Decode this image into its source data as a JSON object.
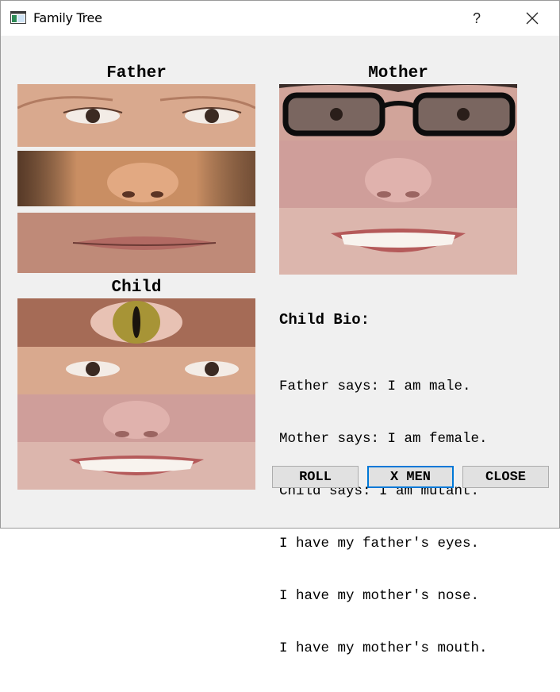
{
  "window": {
    "title": "Family Tree",
    "help_label": "?"
  },
  "sections": {
    "father": "Father",
    "mother": "Mother",
    "child": "Child"
  },
  "bio": {
    "title": "Child Bio:",
    "lines": [
      "Father says: I am male.",
      "Mother says: I am female.",
      "Child says: I am mutant.",
      "I have my father's eyes.",
      "I have my mother's nose.",
      "I have my mother's mouth."
    ]
  },
  "buttons": {
    "roll": "ROLL",
    "xmen": "X MEN",
    "close": "CLOSE"
  },
  "icons": {
    "app": "app-window-icon",
    "close": "close-icon"
  },
  "colors": {
    "accent": "#0078d7",
    "button_bg": "#e1e1e1",
    "window_bg": "#f0f0f0"
  }
}
